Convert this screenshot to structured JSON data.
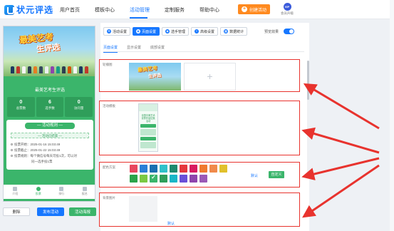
{
  "brand": {
    "name": "状元评选"
  },
  "nav": {
    "items": [
      "用户首页",
      "模板中心",
      "活动管理",
      "定制服务",
      "帮助中心"
    ],
    "active_index": 2,
    "create_label": "创建活动",
    "vip_badge": "VIP",
    "vip_label": "会员升级"
  },
  "preview": {
    "poster_title_line1": "最美艺考",
    "poster_title_line2": "生评选",
    "event_name": "最美艺考生评选",
    "stats": [
      {
        "value": "0",
        "label": "总票数"
      },
      {
        "value": "6",
        "label": "选手数"
      },
      {
        "value": "0",
        "label": "访问量"
      }
    ],
    "rules_title": "— 活动规则 —",
    "status": "— 活动已结束 —",
    "rules": [
      "投票开始：2025-01-16 15:03:49",
      "投票截止：2025-01-22 15:03:49",
      "投票规则：每个微信号每天可投1次，可以对"
    ],
    "rules_cont": "同一选手投1票",
    "bottom_nav": [
      "介绍",
      "投票",
      "排行",
      "报名"
    ],
    "bottom_active": 1
  },
  "actions": {
    "delete": "删除",
    "publish": "发布活动",
    "poster": "活动海报"
  },
  "settings": {
    "tabs": [
      {
        "label": "活动设置",
        "icon": "settings-icon"
      },
      {
        "label": "页面设置",
        "icon": "page-icon"
      },
      {
        "label": "选手管理",
        "icon": "users-icon"
      },
      {
        "label": "高级设置",
        "icon": "advanced-icon"
      },
      {
        "label": "数据统计",
        "icon": "stats-icon"
      }
    ],
    "active_tab": 1,
    "preview_toggle_label": "预览效果",
    "preview_toggle_on": true,
    "subtabs": [
      "页面设置",
      "显示设置",
      "底部设置"
    ],
    "active_subtab": 0,
    "carousel_label": "轮播图",
    "template_label": "活动模板",
    "template_preview_text": "全国中美艺术 优秀作品征集活动",
    "color_label": "配色方案",
    "colors": [
      "#e8475f",
      "#2b7fd6",
      "#1a6fb0",
      "#2fc1c9",
      "#1e8a6e",
      "#e5373d",
      "#d81b60",
      "#ef7a2f",
      "#f08a4b",
      "#e1c12c",
      "#2aa34a",
      "#7bc943",
      "#3bb56b",
      "#2f9e5a",
      "#1ab6c7",
      "#6a4fd8",
      "#8e44ad",
      "#9b59b6"
    ],
    "selected_color_index": 12,
    "color_default": "默认",
    "color_custom": "自定义",
    "bg_label": "背景图片",
    "bg_default": "默认"
  },
  "annotation": {
    "arrow_color": "#e8332e"
  }
}
